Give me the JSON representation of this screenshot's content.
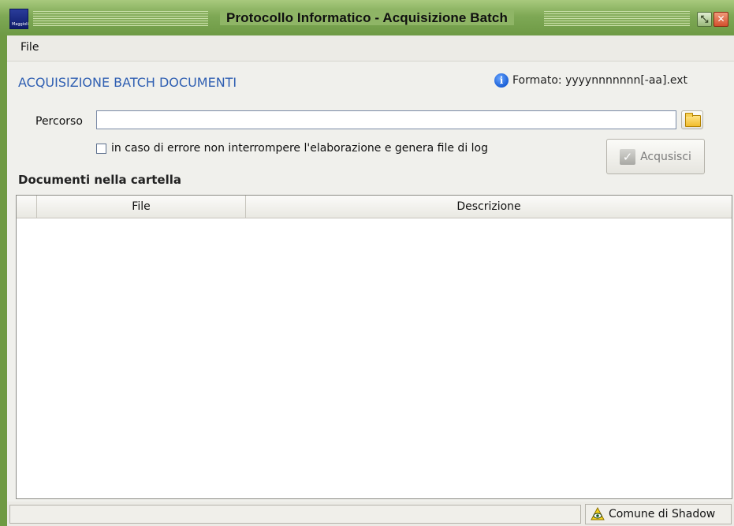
{
  "window": {
    "title": "Protocollo Informatico - Acquisizione Batch",
    "icon_caption": "Maggioli",
    "restore_glyph": "⤡",
    "close_glyph": "✕"
  },
  "menu": {
    "file_label": "File"
  },
  "header": {
    "section_title": "ACQUISIZIONE BATCH DOCUMENTI",
    "format_text": "Formato: yyyynnnnnnn[-aa].ext"
  },
  "form": {
    "path_label": "Percorso",
    "path_value": "",
    "continue_on_error_label": "in caso di errore non interrompere l'elaborazione e genera file di log",
    "continue_on_error_checked": false,
    "acquire_label": "Acqusisci"
  },
  "documents": {
    "title": "Documenti nella cartella",
    "columns": [
      "File",
      "Descrizione"
    ],
    "rows": []
  },
  "status": {
    "left_text": "",
    "right_text": "Comune di Shadow"
  },
  "colors": {
    "accent_title": "#2f5fb2",
    "titlebar": "#7ea855",
    "close": "#d4502e"
  }
}
